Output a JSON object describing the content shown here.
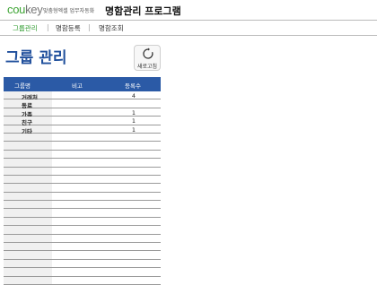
{
  "header": {
    "logo_cou": "cou",
    "logo_key": "key",
    "logo_sub": "맞춤형엑셀 업무자동화",
    "program_title": "명함관리 프로그램"
  },
  "nav": {
    "items": [
      {
        "label": "그룹관리",
        "active": true
      },
      {
        "label": "명함등록",
        "active": false
      },
      {
        "label": "명함조회",
        "active": false
      }
    ]
  },
  "page": {
    "title": "그룹 관리",
    "refresh_label": "새로고침"
  },
  "table": {
    "headers": {
      "name": "그룹명",
      "note": "비고",
      "count": "등록수"
    },
    "rows": [
      {
        "name": "거래처",
        "note": "",
        "count": "4"
      },
      {
        "name": "동료",
        "note": "",
        "count": ""
      },
      {
        "name": "가족",
        "note": "",
        "count": "1"
      },
      {
        "name": "친구",
        "note": "",
        "count": "1"
      },
      {
        "name": "기타",
        "note": "",
        "count": "1"
      },
      {
        "name": "",
        "note": "",
        "count": ""
      },
      {
        "name": "",
        "note": "",
        "count": ""
      },
      {
        "name": "",
        "note": "",
        "count": ""
      },
      {
        "name": "",
        "note": "",
        "count": ""
      },
      {
        "name": "",
        "note": "",
        "count": ""
      },
      {
        "name": "",
        "note": "",
        "count": ""
      },
      {
        "name": "",
        "note": "",
        "count": ""
      },
      {
        "name": "",
        "note": "",
        "count": ""
      },
      {
        "name": "",
        "note": "",
        "count": ""
      },
      {
        "name": "",
        "note": "",
        "count": ""
      },
      {
        "name": "",
        "note": "",
        "count": ""
      },
      {
        "name": "",
        "note": "",
        "count": ""
      },
      {
        "name": "",
        "note": "",
        "count": ""
      },
      {
        "name": "",
        "note": "",
        "count": ""
      },
      {
        "name": "",
        "note": "",
        "count": ""
      },
      {
        "name": "",
        "note": "",
        "count": ""
      },
      {
        "name": "",
        "note": "",
        "count": ""
      },
      {
        "name": "",
        "note": "",
        "count": ""
      }
    ]
  },
  "icons": {
    "refresh": "refresh-icon"
  },
  "colors": {
    "brand_green": "#3fa535",
    "header_blue": "#2b5aa6",
    "title_blue": "#1f4f9c"
  }
}
